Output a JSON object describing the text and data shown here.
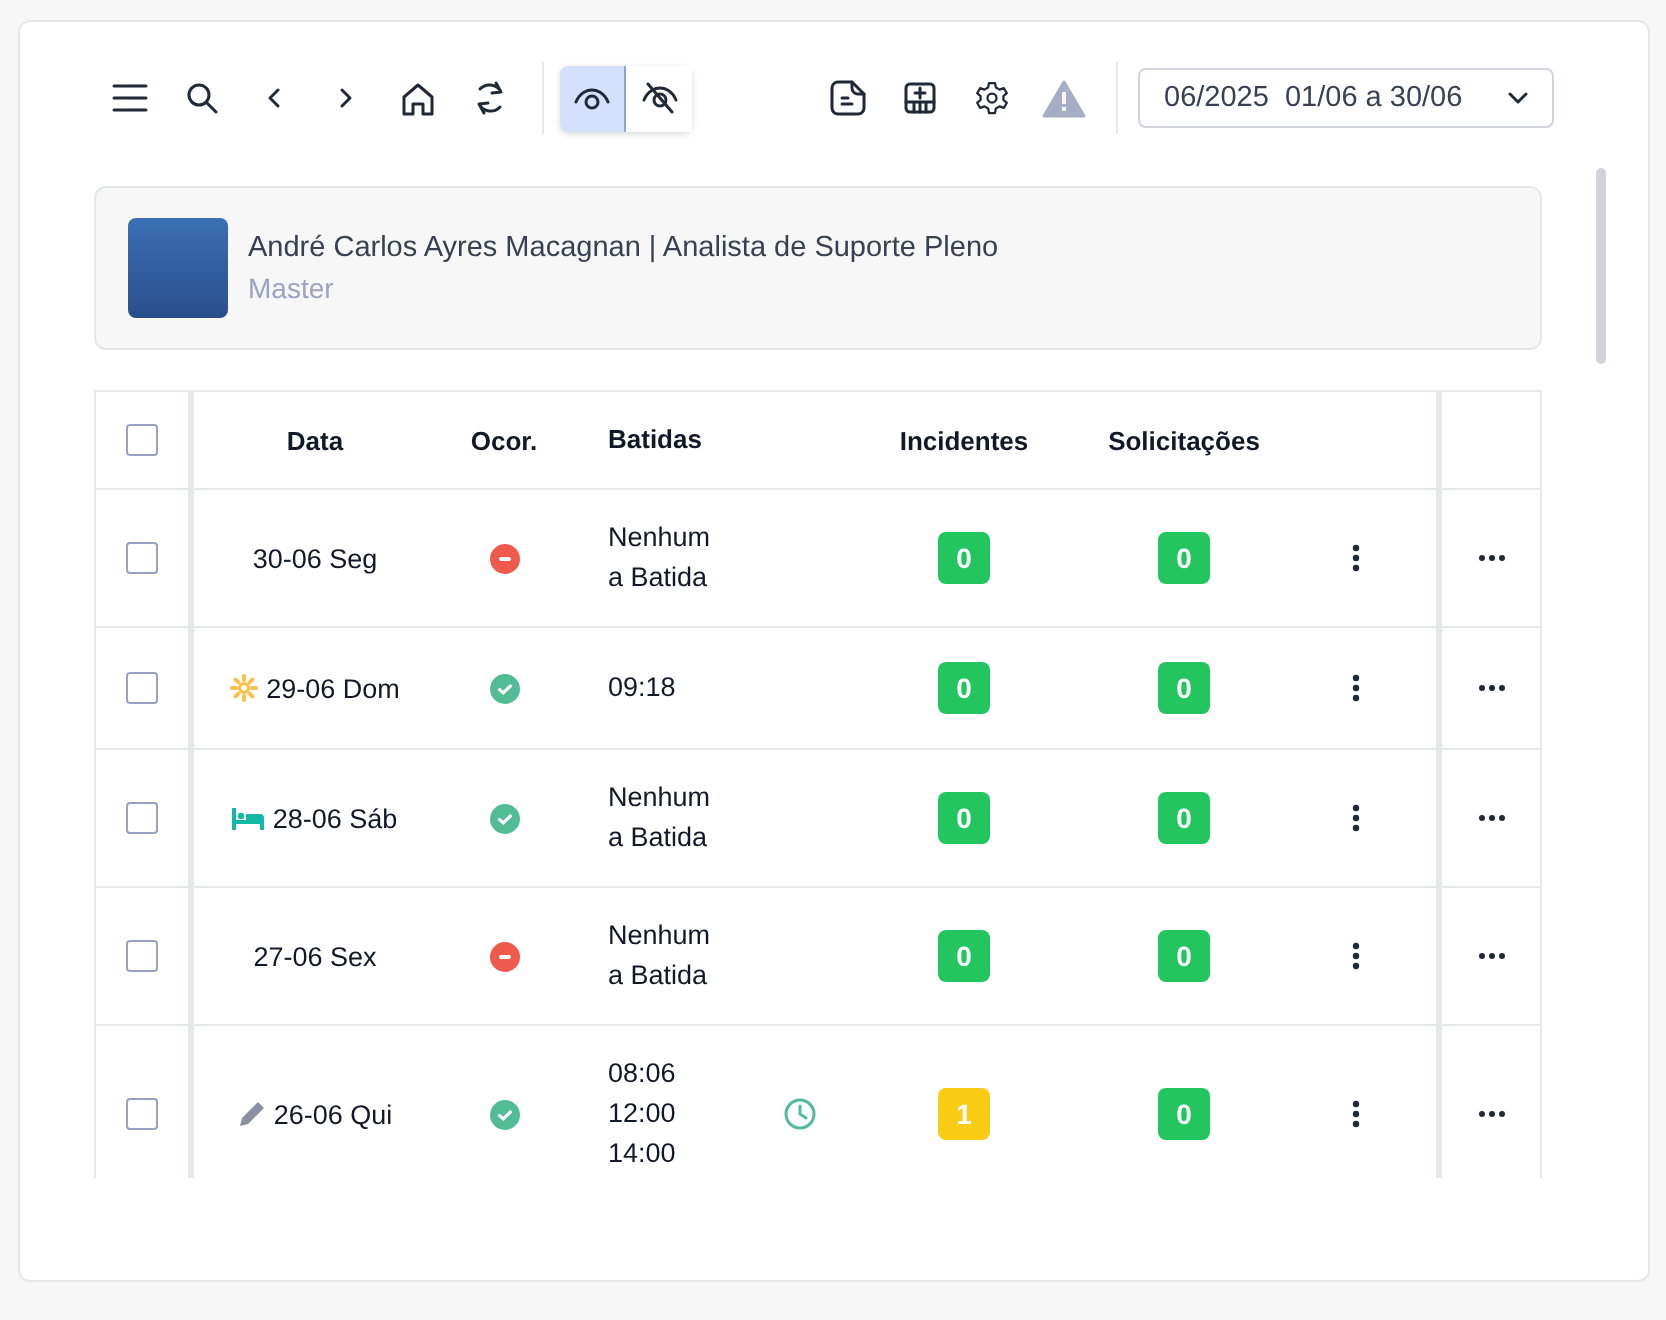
{
  "toolbar": {
    "view_toggles": [
      {
        "kind": "show",
        "selected": true
      },
      {
        "kind": "hide",
        "selected": false
      }
    ],
    "period": "06/2025  01/06 a 30/06"
  },
  "profile": {
    "name": "André Carlos Ayres Macagnan | Analista de Suporte Pleno",
    "role": "Master"
  },
  "table": {
    "select_all": {
      "checked": false
    },
    "columns": [
      "Data",
      "Ocor.",
      "Batidas",
      "Incidentes",
      "Solicitações"
    ],
    "rows": [
      {
        "checked": false,
        "date": "30-06 Seg",
        "ocorrencia": {
          "kind": "missing"
        },
        "batidas": [
          "Nenhum",
          "a Batida"
        ],
        "adjusted": false,
        "incidentes": {
          "value": "0",
          "color": "#22c55e"
        },
        "solicitacoes": {
          "value": "0",
          "color": "#22c55e"
        }
      },
      {
        "checked": false,
        "marker": {
          "kind": "sun"
        },
        "date": "29-06 Dom",
        "ocorrencia": {
          "kind": "ok"
        },
        "batidas": [
          "09:18"
        ],
        "adjusted": false,
        "incidentes": {
          "value": "0",
          "color": "#22c55e"
        },
        "solicitacoes": {
          "value": "0",
          "color": "#22c55e"
        }
      },
      {
        "checked": false,
        "marker": {
          "kind": "bed"
        },
        "date": "28-06 Sáb",
        "ocorrencia": {
          "kind": "ok"
        },
        "batidas": [
          "Nenhum",
          "a Batida"
        ],
        "adjusted": false,
        "incidentes": {
          "value": "0",
          "color": "#22c55e"
        },
        "solicitacoes": {
          "value": "0",
          "color": "#22c55e"
        }
      },
      {
        "checked": false,
        "date": "27-06 Sex",
        "ocorrencia": {
          "kind": "missing"
        },
        "batidas": [
          "Nenhum",
          "a Batida"
        ],
        "adjusted": false,
        "incidentes": {
          "value": "0",
          "color": "#22c55e"
        },
        "solicitacoes": {
          "value": "0",
          "color": "#22c55e"
        }
      },
      {
        "checked": false,
        "marker": {
          "kind": "pencil"
        },
        "date": "26-06 Qui",
        "ocorrencia": {
          "kind": "ok"
        },
        "batidas": [
          "08:06",
          "12:00",
          "14:00"
        ],
        "adjusted": true,
        "incidentes": {
          "value": "1",
          "color": "#facc15"
        },
        "solicitacoes": {
          "value": "0",
          "color": "#22c55e"
        }
      }
    ]
  }
}
